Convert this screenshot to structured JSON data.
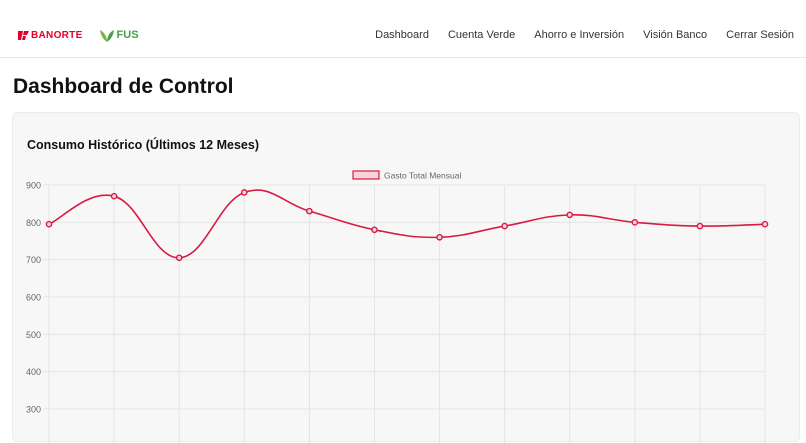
{
  "header": {
    "brand_banorte": "BANORTE",
    "brand_fus": "FUS",
    "nav": [
      "Dashboard",
      "Cuenta Verde",
      "Ahorro e Inversión",
      "Visión Banco",
      "Cerrar Sesión"
    ]
  },
  "page": {
    "title": "Dashboard de Control"
  },
  "card": {
    "title": "Consumo Histórico (Últimos 12 Meses)"
  },
  "colors": {
    "accent": "#e4002b",
    "line": "#d81b45",
    "fus_green": "#43a047"
  },
  "chart_data": {
    "type": "line",
    "legend": [
      "Gasto Total Mensual"
    ],
    "legend_position": "top",
    "grid": true,
    "y_ticks": [
      900,
      800,
      700,
      600,
      500,
      400,
      300
    ],
    "ylim": [
      300,
      900
    ],
    "series": [
      {
        "name": "Gasto Total Mensual",
        "values": [
          795,
          870,
          705,
          880,
          830,
          780,
          760,
          790,
          820,
          800,
          790,
          795
        ]
      }
    ]
  }
}
